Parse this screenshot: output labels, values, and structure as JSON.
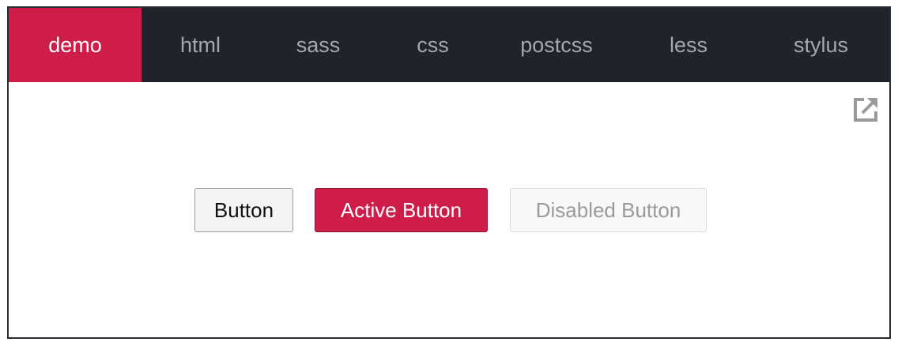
{
  "tabs": [
    {
      "label": "demo",
      "active": true
    },
    {
      "label": "html",
      "active": false
    },
    {
      "label": "sass",
      "active": false
    },
    {
      "label": "css",
      "active": false
    },
    {
      "label": "postcss",
      "active": false
    },
    {
      "label": "less",
      "active": false
    },
    {
      "label": "stylus",
      "active": false
    }
  ],
  "demo": {
    "open_icon": "open-in-new-window-icon",
    "buttons": {
      "default_label": "Button",
      "active_label": "Active Button",
      "disabled_label": "Disabled Button"
    }
  },
  "colors": {
    "accent": "#cf1d49",
    "tabbar_bg": "#21232a",
    "tab_text": "#a5a7ad"
  }
}
